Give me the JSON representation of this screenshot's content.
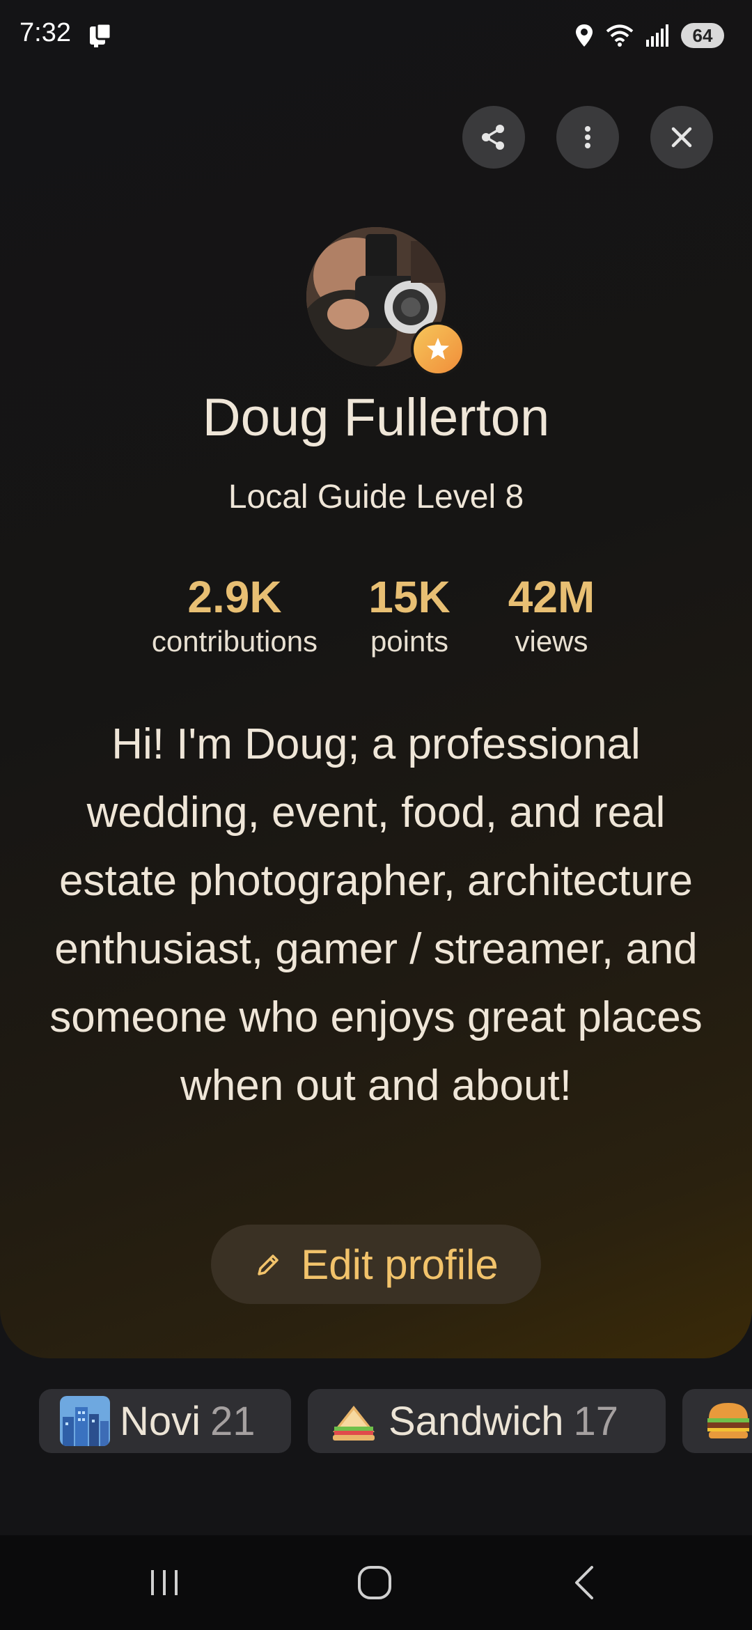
{
  "status_bar": {
    "time": "7:32",
    "battery": "64"
  },
  "profile": {
    "name": "Doug Fullerton",
    "level": "Local Guide Level 8",
    "stats": [
      {
        "value": "2.9K",
        "label": "contributions"
      },
      {
        "value": "15K",
        "label": "points"
      },
      {
        "value": "42M",
        "label": "views"
      }
    ],
    "bio": "Hi!  I'm Doug; a professional wedding, event, food, and real estate photographer, architecture enthusiast, gamer / streamer, and someone who enjoys great places when out and about!",
    "edit_label": "Edit profile"
  },
  "chips": [
    {
      "label": "Novi",
      "count": "21",
      "icon": "cityscape-icon"
    },
    {
      "label": "Sandwich",
      "count": "17",
      "icon": "sandwich-icon"
    },
    {
      "label": "",
      "count": "",
      "icon": "burger-icon"
    }
  ],
  "colors": {
    "accent": "#e8bf73",
    "edit_text": "#f2c36b",
    "background": "#141416"
  }
}
